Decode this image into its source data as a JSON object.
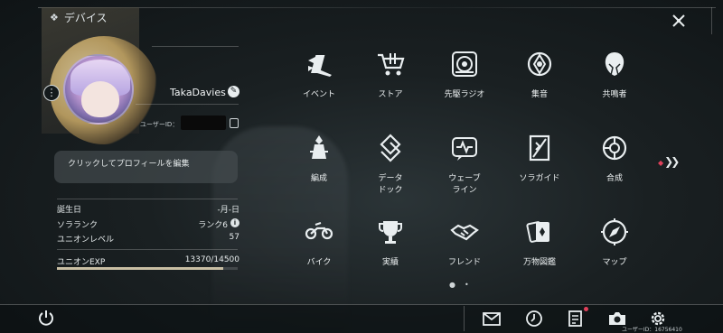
{
  "header": {
    "title": "デバイス"
  },
  "profile": {
    "username": "TakaDavies",
    "user_id_label": "ユーザーID：",
    "bio": "クリックしてプロフィールを編集",
    "stats": [
      {
        "label": "誕生日",
        "value": "-月-日"
      },
      {
        "label": "ソラランク",
        "value": "ランク6"
      },
      {
        "label": "ユニオンレベル",
        "value": "57"
      }
    ],
    "exp": {
      "label": "ユニオンEXP",
      "value_text": "13370/14500",
      "current": 13370,
      "max": 14500
    }
  },
  "menu": [
    {
      "label": "イベント",
      "icon": "event-icon"
    },
    {
      "label": "ストア",
      "icon": "store-cart-icon"
    },
    {
      "label": "先駆ラジオ",
      "icon": "radio-icon"
    },
    {
      "label": "集音",
      "icon": "sound-collect-icon"
    },
    {
      "label": "共鳴者",
      "icon": "resonator-icon"
    },
    {
      "label": "編成",
      "icon": "formation-icon"
    },
    {
      "label": "データ\nドック",
      "icon": "data-dock-icon"
    },
    {
      "label": "ウェーブ\nライン",
      "icon": "wave-line-icon"
    },
    {
      "label": "ソラガイド",
      "icon": "guide-icon"
    },
    {
      "label": "合成",
      "icon": "synthesis-icon"
    },
    {
      "label": "バイク",
      "icon": "bike-icon"
    },
    {
      "label": "実績",
      "icon": "trophy-icon"
    },
    {
      "label": "フレンド",
      "icon": "handshake-icon"
    },
    {
      "label": "万物図鑑",
      "icon": "cards-icon"
    },
    {
      "label": "マップ",
      "icon": "compass-icon"
    }
  ],
  "footer": {
    "user_id_text": "ユーザーID：16756410"
  }
}
